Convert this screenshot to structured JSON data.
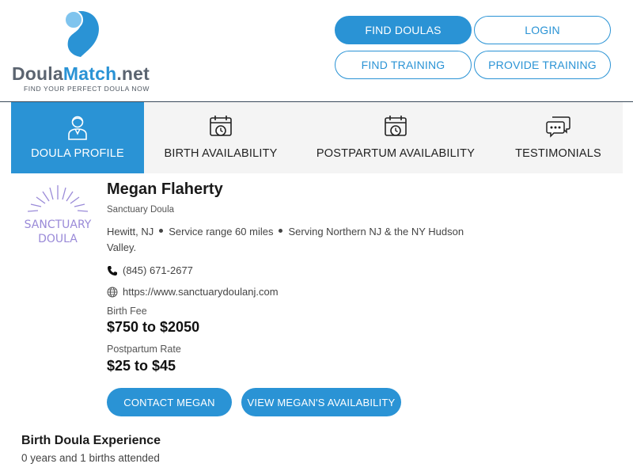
{
  "brand": {
    "name_main": "Doula",
    "name_accent": "Match",
    "name_suffix": ".net",
    "tagline": "FIND YOUR PERFECT DOULA NOW",
    "accent_color": "#2a93d5"
  },
  "nav": {
    "find_doulas": "FIND DOULAS",
    "login": "LOGIN",
    "find_training": "FIND TRAINING",
    "provide_training": "PROVIDE TRAINING"
  },
  "tabs": [
    {
      "label": "DOULA PROFILE",
      "icon": "person-icon",
      "active": true
    },
    {
      "label": "BIRTH AVAILABILITY",
      "icon": "calendar-clock-icon",
      "active": false
    },
    {
      "label": "POSTPARTUM AVAILABILITY",
      "icon": "calendar-clock-icon",
      "active": false
    },
    {
      "label": "TESTIMONIALS",
      "icon": "chat-bubbles-icon",
      "active": false
    }
  ],
  "profile": {
    "avatar_text_line1": "SANCTUARY",
    "avatar_text_line2": "DOULA",
    "name": "Megan Flaherty",
    "organization": "Sanctuary Doula",
    "location": "Hewitt, NJ",
    "service_range": "Service range 60 miles",
    "serving": "Serving Northern NJ & the NY Hudson Valley.",
    "phone": "(845) 671-2677",
    "website": "https://www.sanctuarydoulanj.com",
    "birth_fee_label": "Birth Fee",
    "birth_fee": "$750 to $2050",
    "postpartum_rate_label": "Postpartum Rate",
    "postpartum_rate": "$25 to $45",
    "contact_button": "CONTACT MEGAN",
    "availability_button": "VIEW MEGAN'S AVAILABILITY"
  },
  "experience": {
    "title": "Birth Doula Experience",
    "text": "0 years and 1 births attended"
  }
}
